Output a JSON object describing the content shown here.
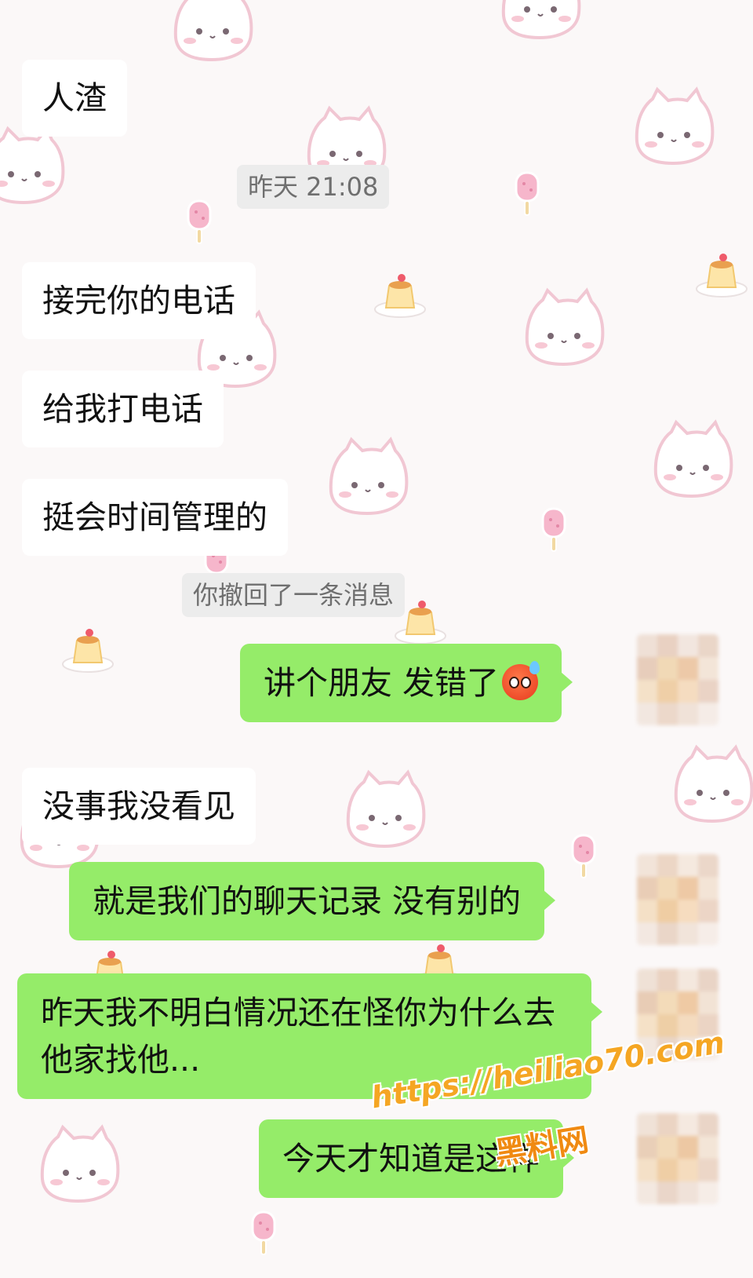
{
  "chat": {
    "messages": [
      {
        "side": "in",
        "text": "人渣"
      },
      {
        "side": "sys",
        "text": "昨天 21:08"
      },
      {
        "side": "in",
        "text": "接完你的电话"
      },
      {
        "side": "in",
        "text": "给我打电话"
      },
      {
        "side": "in",
        "text": "挺会时间管理的"
      },
      {
        "side": "sys",
        "text": "你撤回了一条消息"
      },
      {
        "side": "out",
        "text": "讲个朋友 发错了",
        "emoji": "hot-face-sweat-emoji"
      },
      {
        "side": "in",
        "text": "没事我没看见"
      },
      {
        "side": "out",
        "text": "就是我们的聊天记录 没有别的"
      },
      {
        "side": "out",
        "text": "昨天我不明白情况还在怪你为什么去他家找他..."
      },
      {
        "side": "out",
        "text": "今天才知道是这样"
      }
    ]
  },
  "watermark": {
    "url": "https://heiliao70.com",
    "site_name": "黑料网"
  },
  "colors": {
    "outgoing_bubble": "#95ec69",
    "incoming_bubble": "#ffffff",
    "system_tag": "#ececec",
    "background": "#fbf8f8"
  }
}
